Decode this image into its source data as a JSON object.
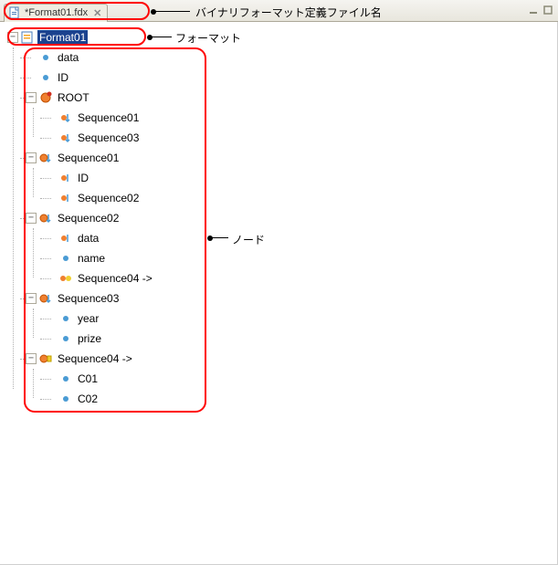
{
  "tab": {
    "title": "*Format01.fdx",
    "icon": "file-icon"
  },
  "annotations": {
    "filename_label": "バイナリフォーマット定義ファイル名",
    "format_label": "フォーマット",
    "node_label": "ノード"
  },
  "tree": {
    "root": {
      "label": "Format01",
      "expanded": true,
      "selected": true,
      "icon": "format-root-icon",
      "children": [
        {
          "label": "data",
          "icon": "attribute-icon",
          "leaf": true
        },
        {
          "label": "ID",
          "icon": "attribute-icon",
          "leaf": true
        },
        {
          "label": "ROOT",
          "icon": "root-seq-icon",
          "expanded": true,
          "children": [
            {
              "label": "Sequence01",
              "icon": "seq-ref-icon",
              "leaf": true
            },
            {
              "label": "Sequence03",
              "icon": "seq-ref-icon",
              "leaf": true
            }
          ]
        },
        {
          "label": "Sequence01",
          "icon": "sequence-icon",
          "expanded": true,
          "children": [
            {
              "label": "ID",
              "icon": "seq-ref-icon",
              "leaf": true
            },
            {
              "label": "Sequence02",
              "icon": "seq-ref-icon",
              "leaf": true
            }
          ]
        },
        {
          "label": "Sequence02",
          "icon": "sequence-icon",
          "expanded": true,
          "children": [
            {
              "label": "data",
              "icon": "seq-ref-icon",
              "leaf": true
            },
            {
              "label": "name",
              "icon": "attribute-icon",
              "leaf": true
            },
            {
              "label": "Sequence04 ->",
              "icon": "seq-link-icon",
              "leaf": true
            }
          ]
        },
        {
          "label": "Sequence03",
          "icon": "sequence-icon",
          "expanded": true,
          "children": [
            {
              "label": "year",
              "icon": "attribute-icon",
              "leaf": true
            },
            {
              "label": "prize",
              "icon": "attribute-icon",
              "leaf": true
            }
          ]
        },
        {
          "label": "Sequence04 ->",
          "icon": "sequence-link-icon",
          "expanded": true,
          "children": [
            {
              "label": "C01",
              "icon": "attribute-icon",
              "leaf": true
            },
            {
              "label": "C02",
              "icon": "attribute-icon",
              "leaf": true
            }
          ]
        }
      ]
    }
  }
}
